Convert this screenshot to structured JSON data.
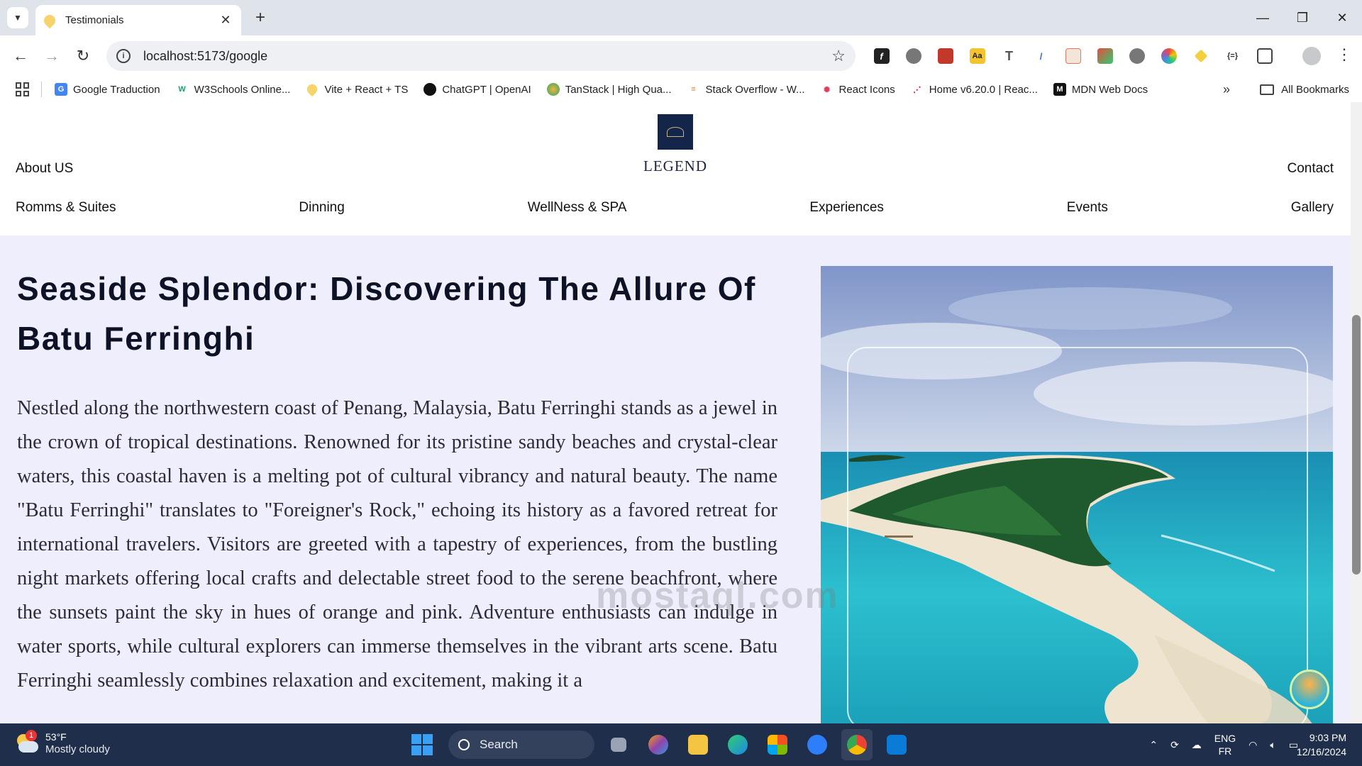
{
  "browser": {
    "tab_title": "Testimonials",
    "url": "localhost:5173/google",
    "bookmarks": [
      "Google Traduction",
      "W3Schools Online...",
      "Vite + React + TS",
      "ChatGPT | OpenAI",
      "TanStack | High Qua...",
      "Stack Overflow - W...",
      "React Icons",
      "Home v6.20.0 | Reac...",
      "MDN Web Docs"
    ],
    "all_bookmarks": "All Bookmarks"
  },
  "site": {
    "logo_text": "LEGEND",
    "nav_top_left": "About US",
    "nav_top_right": "Contact",
    "nav": [
      "Romms & Suites",
      "Dinning",
      "WellNess & SPA",
      "Experiences",
      "Events",
      "Gallery"
    ]
  },
  "article": {
    "title": "Seaside Splendor: Discovering The Allure Of Batu Ferringhi",
    "body": "Nestled along the northwestern coast of Penang, Malaysia, Batu Ferringhi stands as a jewel in the crown of tropical destinations. Renowned for its pristine sandy beaches and crystal-clear waters, this coastal haven is a melting pot of cultural vibrancy and natural beauty. The name \"Batu Ferringhi\" translates to \"Foreigner's Rock,\" echoing its history as a favored retreat for international travelers. Visitors are greeted with a tapestry of experiences, from the bustling night markets offering local crafts and delectable street food to the serene beachfront, where the sunsets paint the sky in hues of orange and pink. Adventure enthusiasts can indulge in water sports, while cultural explorers can immerse themselves in the vibrant arts scene. Batu Ferringhi seamlessly combines relaxation and excitement, making it a"
  },
  "watermark": "mostaql.com",
  "taskbar": {
    "temperature": "53°F",
    "condition": "Mostly cloudy",
    "weather_badge": "1",
    "search_label": "Search",
    "lang_1": "ENG",
    "lang_2": "FR",
    "time": "9:03 PM",
    "date": "12/16/2024"
  },
  "colors": {
    "content_bg": "#eeeefc",
    "logo_bg": "#14254a",
    "taskbar_bg": "#1f2e4a"
  },
  "icons": {
    "tab_favicon": "vite-favicon-icon",
    "address_info": "site-info-icon",
    "bookmark_star": "star-icon"
  }
}
